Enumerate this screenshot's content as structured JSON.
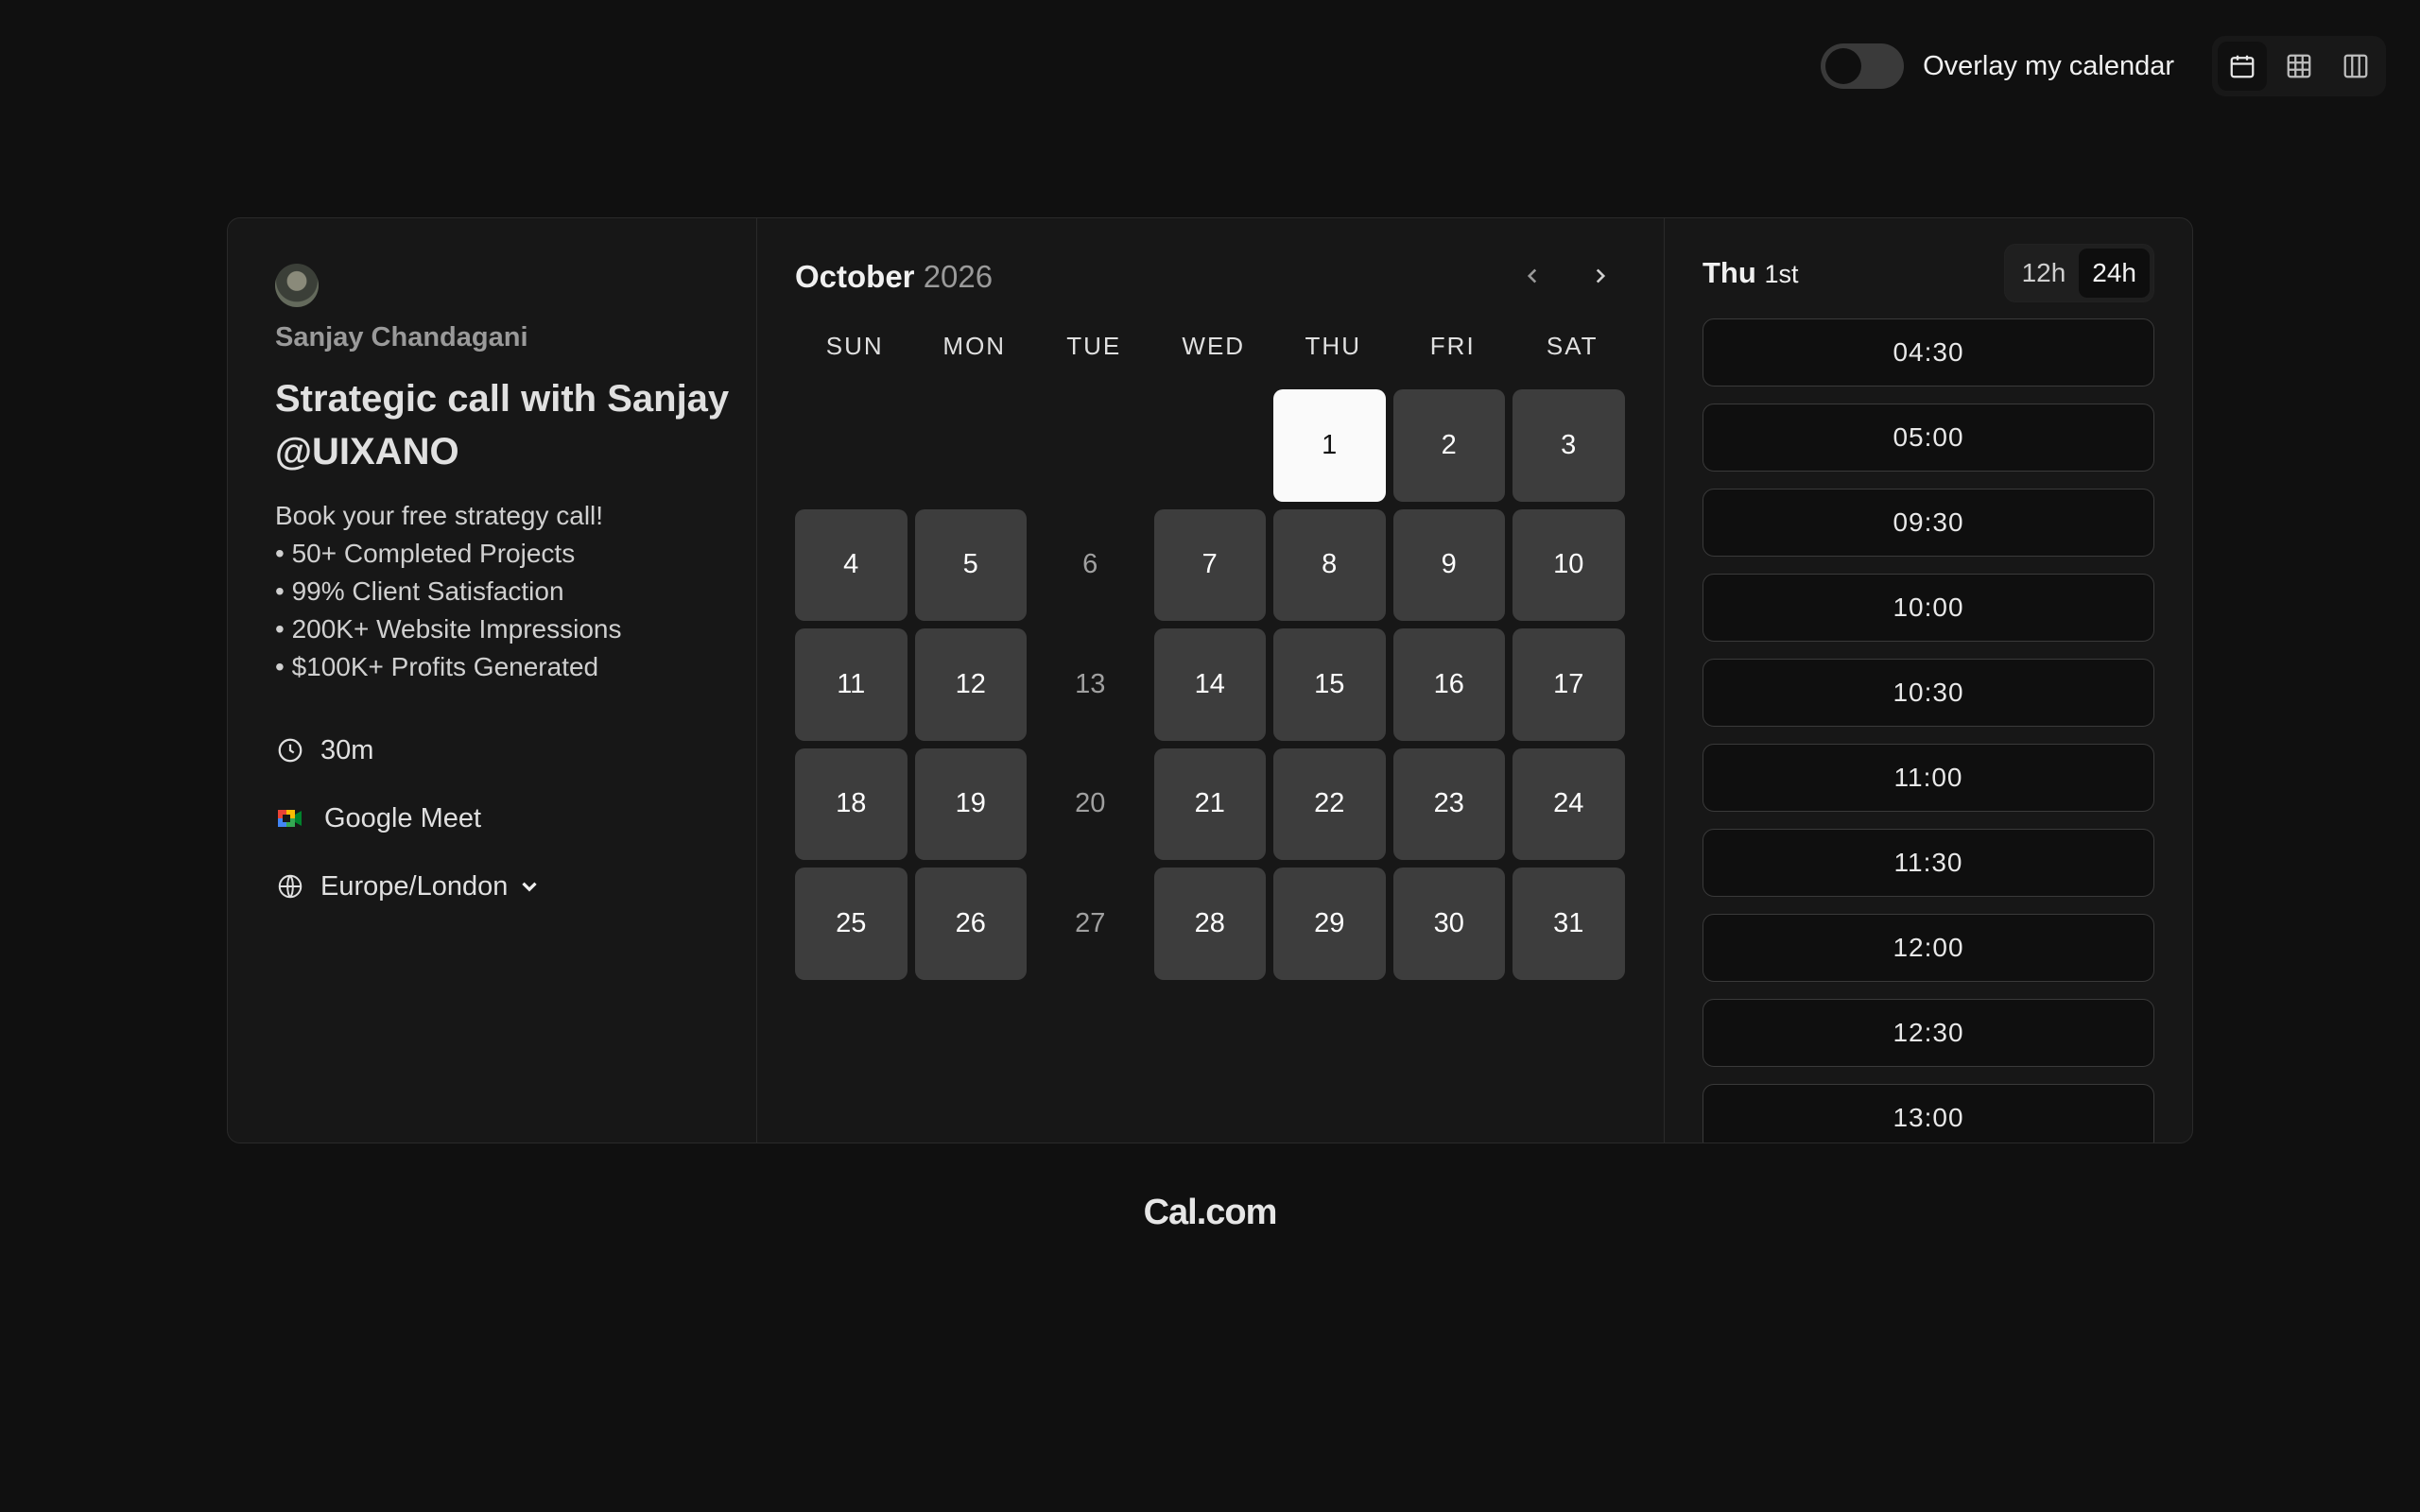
{
  "topbar": {
    "overlay_label": "Overlay my calendar",
    "overlay_on": false,
    "views": [
      "calendar-icon",
      "grid-icon",
      "columns-icon"
    ]
  },
  "profile": {
    "host": "Sanjay Chandagani",
    "title": "Strategic call with Sanjay @UIXANO",
    "description": [
      "Book your free strategy call!",
      "• 50+ Completed Projects",
      "• 99% Client Satisfaction",
      "• 200K+ Website Impressions",
      "• $100K+ Profits Generated"
    ],
    "duration": "30m",
    "location": "Google Meet",
    "timezone": "Europe/London"
  },
  "calendar": {
    "month": "October",
    "year": "2026",
    "weekdays": [
      "SUN",
      "MON",
      "TUE",
      "WED",
      "THU",
      "FRI",
      "SAT"
    ],
    "leading_blanks": 4,
    "days_in_month": 31,
    "selected_day": 1,
    "unavailable_days": [
      6,
      13,
      20,
      27
    ]
  },
  "slots_panel": {
    "day_name": "Thu",
    "day_num": "1st",
    "format_12": "12h",
    "format_24": "24h",
    "active_format": "24h",
    "times": [
      "04:30",
      "05:00",
      "09:30",
      "10:00",
      "10:30",
      "11:00",
      "11:30",
      "12:00",
      "12:30",
      "13:00"
    ]
  },
  "footer": {
    "brand": "Cal.com"
  },
  "colors": {
    "background": "#101010",
    "card": "#171717",
    "available_day": "#3d3d3d",
    "selected_day": "#fafafa"
  }
}
